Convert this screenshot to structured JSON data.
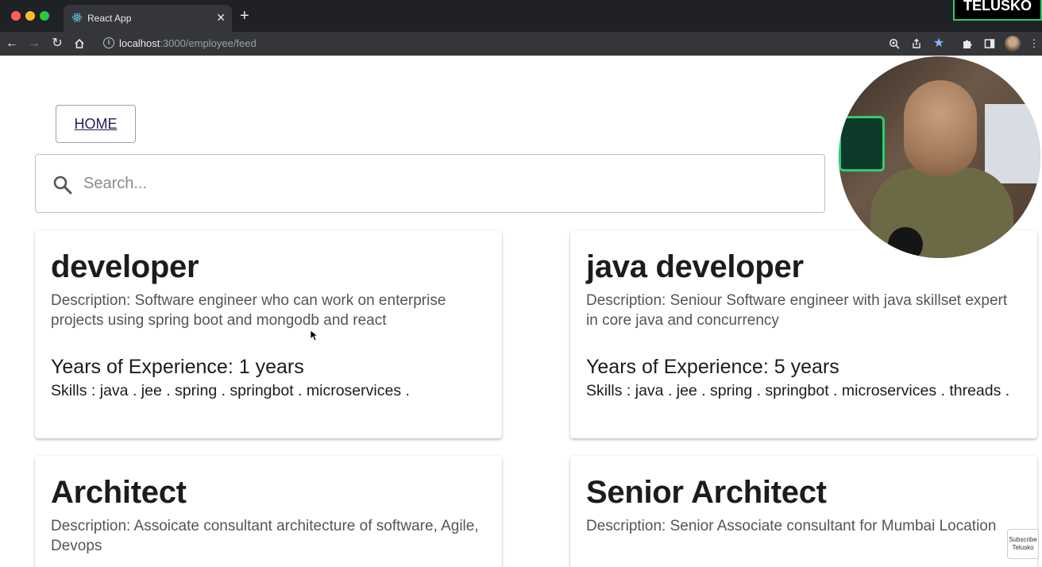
{
  "browser": {
    "tab_title": "React App",
    "new_tab_symbol": "+",
    "close_symbol": "✕",
    "url_host": "localhost",
    "url_path": ":3000/employee/feed",
    "overlay_brand": "TELUSKO"
  },
  "page": {
    "home_label": "HOME",
    "search_placeholder": "Search...",
    "cards": [
      {
        "title": "developer",
        "description": "Description: Software engineer who can work on enterprise projects using spring boot and mongodb and react",
        "experience": "Years of Experience: 1 years",
        "skills": "Skills : java . jee . spring . springbot . microservices ."
      },
      {
        "title": "java developer",
        "description": "Description: Seniour Software engineer with java skillset expert in core java and concurrency",
        "experience": "Years of Experience: 5 years",
        "skills": "Skills : java . jee . spring . springbot . microservices . threads ."
      },
      {
        "title": "Architect",
        "description": "Description: Assoicate consultant architecture of software, Agile, Devops"
      },
      {
        "title": "Senior Architect",
        "description": "Description: Senior Associate consultant for Mumbai Location"
      }
    ],
    "subscribe_line1": "Subscribe",
    "subscribe_line2": "Telusko"
  }
}
